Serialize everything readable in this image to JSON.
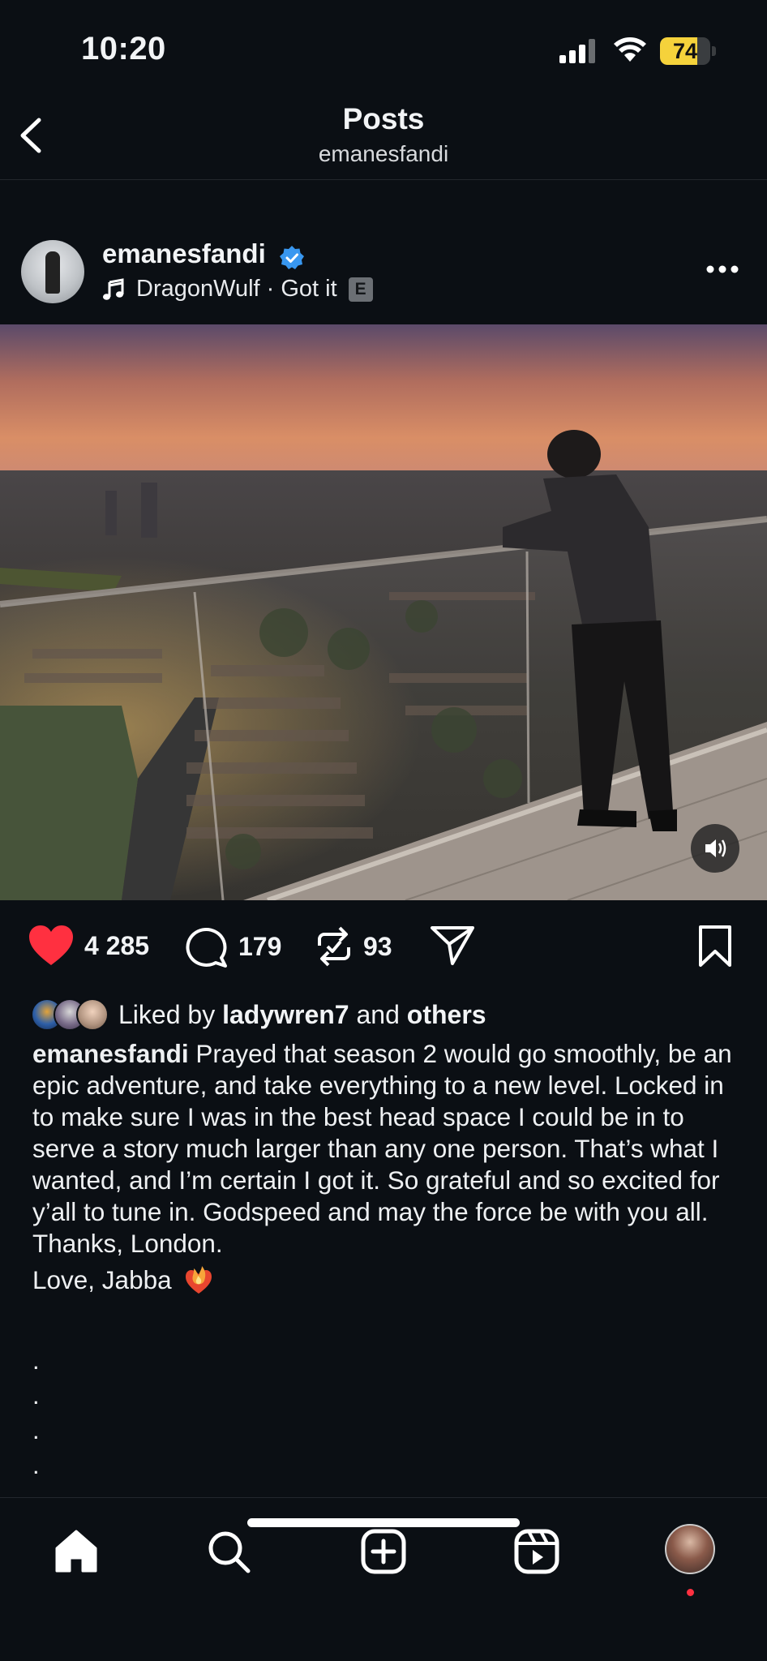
{
  "status_bar": {
    "time": "10:20",
    "battery_percent": 74,
    "battery_label": "74"
  },
  "header": {
    "title": "Posts",
    "subtitle": "emanesfandi"
  },
  "post": {
    "username": "emanesfandi",
    "verified": true,
    "music": "DragonWulf · Got it",
    "explicit_badge": "E",
    "likes_count": "4 285",
    "comments_count": "179",
    "reposts_count": "93",
    "liked_by_prefix": "Liked by",
    "liked_by_user": "ladywren7",
    "liked_by_and": "and",
    "liked_by_others": "others",
    "caption_user": "emanesfandi",
    "caption_text": "Prayed that season 2 would go smoothly, be an epic adventure, and take everything to a new level. Locked in to make sure I was in the best head space I could be in to serve a story much larger than any one person. That’s what I wanted, and I’m certain I got it. So grateful and so excited for y’all to tune in. Godspeed and may the force be with you all. Thanks, London.",
    "signoff": "Love, Jabba",
    "dots": [
      ".",
      ".",
      ".",
      ".",
      "."
    ]
  },
  "icons": {
    "back": "chevron-left-icon",
    "more": "more-horizontal-icon",
    "like": "heart-filled-icon",
    "comment": "comment-bubble-icon",
    "repost": "repost-icon",
    "share": "send-icon",
    "save": "bookmark-icon",
    "sound": "speaker-icon",
    "nav": [
      "home-icon",
      "search-icon",
      "create-icon",
      "reels-icon",
      "profile-avatar"
    ]
  },
  "colors": {
    "background": "#0b0f14",
    "like_red": "#ff3040",
    "verified_blue": "#3897f0",
    "battery_yellow": "#f5d23b"
  }
}
